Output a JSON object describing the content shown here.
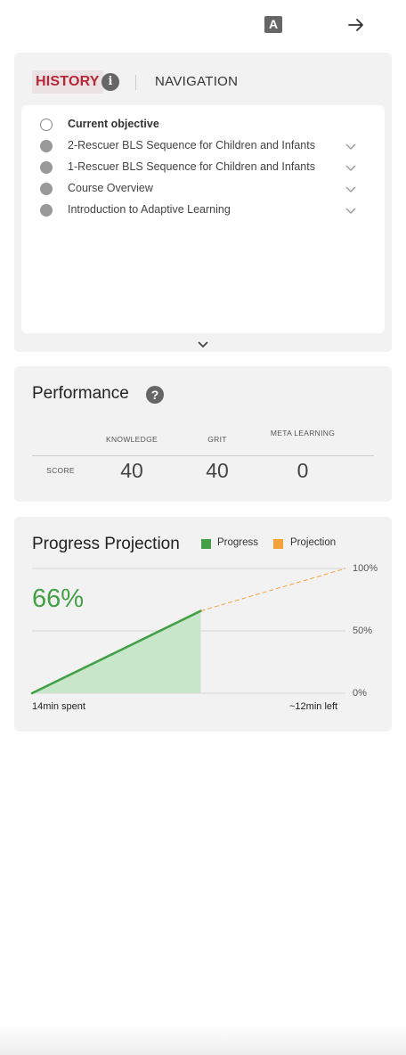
{
  "topbar": {
    "font_icon_letter": "A"
  },
  "history": {
    "tab_history": "HISTORY",
    "tab_navigation": "NAVIGATION",
    "info_glyph": "i",
    "items": [
      {
        "label": "Current objective",
        "state": "current"
      },
      {
        "label": "2-Rescuer BLS Sequence for Children and Infants",
        "state": "done"
      },
      {
        "label": "1-Rescuer BLS Sequence for Children and Infants",
        "state": "done"
      },
      {
        "label": "Course Overview",
        "state": "done"
      },
      {
        "label": "Introduction to Adaptive Learning",
        "state": "done"
      }
    ]
  },
  "performance": {
    "title": "Performance",
    "help_glyph": "?",
    "columns": [
      "KNOWLEDGE",
      "GRIT",
      "META LEARNING"
    ],
    "row_label": "SCORE",
    "values": [
      "40",
      "40",
      "0"
    ]
  },
  "progress": {
    "title": "Progress Projection",
    "legend": [
      {
        "label": "Progress",
        "color": "#43a047"
      },
      {
        "label": "Projection",
        "color": "#f4a23c"
      }
    ],
    "percent_label": "66%",
    "percent_value": 66,
    "ticks": [
      "100%",
      "50%",
      "0%"
    ],
    "spent_label": "14min spent",
    "left_label": "~12min  left"
  },
  "chart_data": {
    "type": "area",
    "title": "Progress Projection",
    "series": [
      {
        "name": "Progress",
        "x": [
          0,
          14
        ],
        "values": [
          0,
          66
        ]
      },
      {
        "name": "Projection",
        "x": [
          14,
          26
        ],
        "values": [
          66,
          100
        ]
      }
    ],
    "ylim": [
      0,
      100
    ],
    "ticks": [
      "0%",
      "50%",
      "100%"
    ],
    "xlabel_left": "14min spent",
    "xlabel_right": "~12min  left",
    "grid": true,
    "legend_position": "top"
  }
}
